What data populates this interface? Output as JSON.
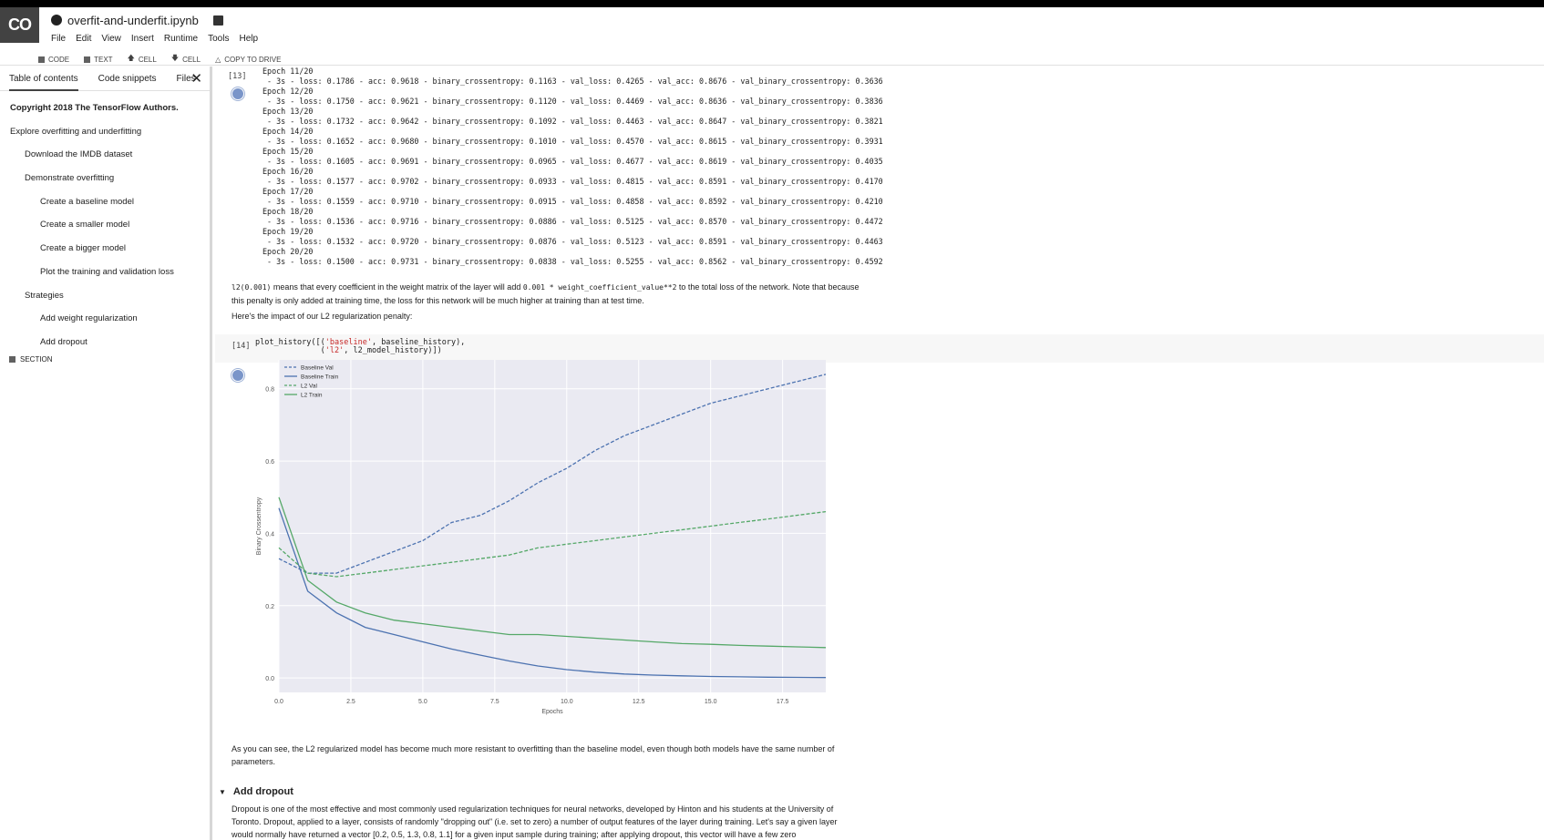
{
  "header": {
    "logo": "CO",
    "filename": "overfit-and-underfit.ipynb",
    "menus": [
      "File",
      "Edit",
      "View",
      "Insert",
      "Runtime",
      "Tools",
      "Help"
    ],
    "toolbar": {
      "code": "CODE",
      "text": "TEXT",
      "cell_up": "CELL",
      "cell_down": "CELL",
      "copy_drive": "COPY TO DRIVE"
    }
  },
  "sidebar": {
    "tabs": [
      "Table of contents",
      "Code snippets",
      "Files"
    ],
    "toc": [
      {
        "label": "Copyright 2018 The TensorFlow Authors.",
        "level": 1,
        "bold": true
      },
      {
        "label": "Explore overfitting and underfitting",
        "level": 1
      },
      {
        "label": "Download the IMDB dataset",
        "level": 2
      },
      {
        "label": "Demonstrate overfitting",
        "level": 2
      },
      {
        "label": "Create a baseline model",
        "level": 3
      },
      {
        "label": "Create a smaller model",
        "level": 3
      },
      {
        "label": "Create a bigger model",
        "level": 3
      },
      {
        "label": "Plot the training and validation loss",
        "level": 3
      },
      {
        "label": "Strategies",
        "level": 2
      },
      {
        "label": "Add weight regularization",
        "level": 3
      },
      {
        "label": "Add dropout",
        "level": 3
      }
    ],
    "section_label": "SECTION"
  },
  "cell13": {
    "exec": "[13]",
    "lines": [
      "Epoch 11/20",
      " - 3s - loss: 0.1786 - acc: 0.9618 - binary_crossentropy: 0.1163 - val_loss: 0.4265 - val_acc: 0.8676 - val_binary_crossentropy: 0.3636",
      "Epoch 12/20",
      " - 3s - loss: 0.1750 - acc: 0.9621 - binary_crossentropy: 0.1120 - val_loss: 0.4469 - val_acc: 0.8636 - val_binary_crossentropy: 0.3836",
      "Epoch 13/20",
      " - 3s - loss: 0.1732 - acc: 0.9642 - binary_crossentropy: 0.1092 - val_loss: 0.4463 - val_acc: 0.8647 - val_binary_crossentropy: 0.3821",
      "Epoch 14/20",
      " - 3s - loss: 0.1652 - acc: 0.9680 - binary_crossentropy: 0.1010 - val_loss: 0.4570 - val_acc: 0.8615 - val_binary_crossentropy: 0.3931",
      "Epoch 15/20",
      " - 3s - loss: 0.1605 - acc: 0.9691 - binary_crossentropy: 0.0965 - val_loss: 0.4677 - val_acc: 0.8619 - val_binary_crossentropy: 0.4035",
      "Epoch 16/20",
      " - 3s - loss: 0.1577 - acc: 0.9702 - binary_crossentropy: 0.0933 - val_loss: 0.4815 - val_acc: 0.8591 - val_binary_crossentropy: 0.4170",
      "Epoch 17/20",
      " - 3s - loss: 0.1559 - acc: 0.9710 - binary_crossentropy: 0.0915 - val_loss: 0.4858 - val_acc: 0.8592 - val_binary_crossentropy: 0.4210",
      "Epoch 18/20",
      " - 3s - loss: 0.1536 - acc: 0.9716 - binary_crossentropy: 0.0886 - val_loss: 0.5125 - val_acc: 0.8570 - val_binary_crossentropy: 0.4472",
      "Epoch 19/20",
      " - 3s - loss: 0.1532 - acc: 0.9720 - binary_crossentropy: 0.0876 - val_loss: 0.5123 - val_acc: 0.8591 - val_binary_crossentropy: 0.4463",
      "Epoch 20/20",
      " - 3s - loss: 0.1500 - acc: 0.9731 - binary_crossentropy: 0.0838 - val_loss: 0.5255 - val_acc: 0.8562 - val_binary_crossentropy: 0.4592"
    ]
  },
  "text1": {
    "code1": "l2(0.001)",
    "part1": " means that every coefficient in the weight matrix of the layer will add ",
    "code2": "0.001 * weight_coefficient_value**2",
    "part2": " to the total loss of the network. Note that because this penalty is only added at training time, the loss for this network will be much higher at training than at test time.",
    "line2": "Here's the impact of our L2 regularization penalty:"
  },
  "cell14": {
    "exec": "[14]",
    "line1_a": "plot_history([(",
    "line1_s": "'baseline'",
    "line1_b": ", baseline_history),",
    "line2_a": "              (",
    "line2_s": "'l2'",
    "line2_b": ", l2_model_history)])"
  },
  "chart_data": {
    "type": "line",
    "xlabel": "Epochs",
    "ylabel": "Binary Crossentropy",
    "xlim": [
      0,
      19
    ],
    "ylim": [
      -0.04,
      0.88
    ],
    "xticks": [
      "0.0",
      "2.5",
      "5.0",
      "7.5",
      "10.0",
      "12.5",
      "15.0",
      "17.5"
    ],
    "yticks": [
      "0.0",
      "0.2",
      "0.4",
      "0.6",
      "0.8"
    ],
    "legend_position": "top-left",
    "x": [
      0,
      1,
      2,
      3,
      4,
      5,
      6,
      7,
      8,
      9,
      10,
      11,
      12,
      13,
      14,
      15,
      16,
      17,
      18,
      19
    ],
    "series": [
      {
        "name": "Baseline Val",
        "color": "#4c72b0",
        "style": "dashed",
        "values": [
          0.33,
          0.29,
          0.29,
          0.32,
          0.35,
          0.38,
          0.43,
          0.45,
          0.49,
          0.54,
          0.58,
          0.63,
          0.67,
          0.7,
          0.73,
          0.76,
          0.78,
          0.8,
          0.82,
          0.84
        ]
      },
      {
        "name": "Baseline Train",
        "color": "#4c72b0",
        "style": "solid",
        "values": [
          0.47,
          0.24,
          0.18,
          0.14,
          0.12,
          0.1,
          0.08,
          0.063,
          0.047,
          0.033,
          0.023,
          0.016,
          0.011,
          0.008,
          0.006,
          0.004,
          0.003,
          0.002,
          0.0015,
          0.001
        ]
      },
      {
        "name": "L2 Val",
        "color": "#55a868",
        "style": "dashed",
        "values": [
          0.36,
          0.29,
          0.28,
          0.29,
          0.3,
          0.31,
          0.32,
          0.33,
          0.34,
          0.36,
          0.37,
          0.38,
          0.39,
          0.4,
          0.41,
          0.42,
          0.43,
          0.44,
          0.45,
          0.46
        ]
      },
      {
        "name": "L2 Train",
        "color": "#55a868",
        "style": "solid",
        "values": [
          0.5,
          0.27,
          0.21,
          0.18,
          0.16,
          0.15,
          0.14,
          0.13,
          0.12,
          0.12,
          0.115,
          0.11,
          0.105,
          0.1,
          0.095,
          0.093,
          0.09,
          0.088,
          0.086,
          0.084
        ]
      }
    ]
  },
  "text2": "As you can see, the L2 regularized model has become much more resistant to overfitting than the baseline model, even though both models have the same number of parameters.",
  "section": {
    "title": "Add dropout",
    "body": "Dropout is one of the most effective and most commonly used regularization techniques for neural networks, developed by Hinton and his students at the University of Toronto. Dropout, applied to a layer, consists of randomly \"dropping out\" (i.e. set to zero) a number of output features of the layer during training. Let's say a given layer would normally have returned a vector [0.2, 0.5, 1.3, 0.8, 1.1] for a given input sample during training; after applying dropout, this vector will have a few zero"
  }
}
